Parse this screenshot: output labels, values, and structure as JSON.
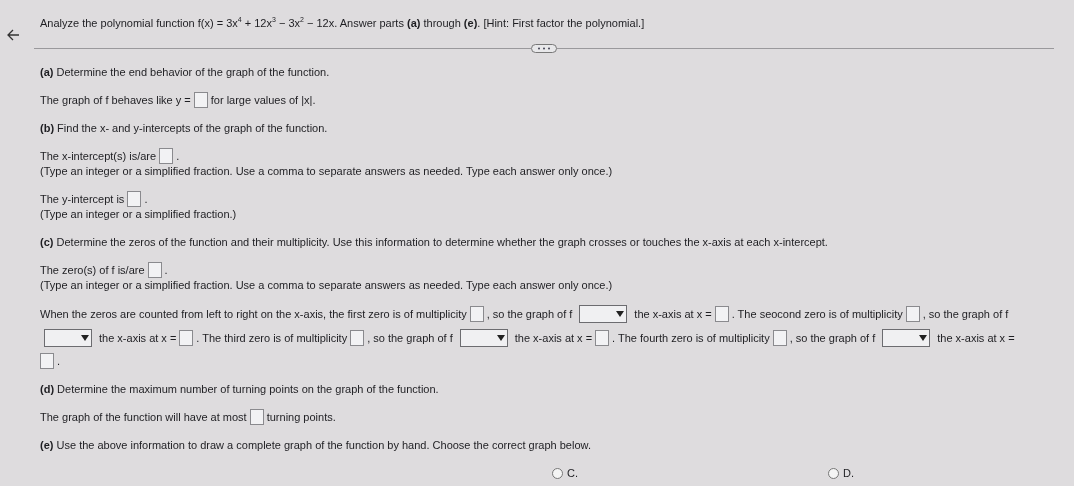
{
  "header": {
    "instruction": "Analyze the polynomial function f(x) = 3x$^{4}$ + 12x$^{3}$ − 3x$^{2}$ − 12x. Answer parts **(a)** through **(e)**. [Hint: First factor the polynomial.]"
  },
  "lines": [
    {
      "kind": "heading",
      "parts": [
        {
          "kind": "text",
          "text": "**(a)** Determine the end behavior of the graph of the function."
        }
      ]
    },
    {
      "kind": "prompt",
      "parts": [
        {
          "kind": "text",
          "text": "The graph of f behaves like y ="
        },
        {
          "kind": "box"
        },
        {
          "kind": "text",
          "text": "for large values of |x|."
        }
      ]
    },
    {
      "kind": "heading",
      "parts": [
        {
          "kind": "text",
          "text": "**(b)** Find the x- and y-intercepts of the graph of the function."
        }
      ]
    },
    {
      "kind": "prompt",
      "parts": [
        {
          "kind": "text",
          "text": "The x-intercept(s) is/are"
        },
        {
          "kind": "box"
        },
        {
          "kind": "text",
          "text": "."
        }
      ]
    },
    {
      "kind": "note",
      "parts": [
        {
          "kind": "text",
          "text": "(Type an integer or a simplified fraction. Use a comma to separate answers as needed. Type each answer only once.)"
        }
      ]
    },
    {
      "kind": "prompt",
      "parts": [
        {
          "kind": "text",
          "text": "The y-intercept is"
        },
        {
          "kind": "box"
        },
        {
          "kind": "text",
          "text": "."
        }
      ]
    },
    {
      "kind": "note",
      "parts": [
        {
          "kind": "text",
          "text": "(Type an integer or a simplified fraction.)"
        }
      ]
    },
    {
      "kind": "heading",
      "parts": [
        {
          "kind": "text",
          "text": "**(c)** Determine the zeros of the function and their multiplicity. Use this information to determine whether the graph crosses or touches the x-axis at each x-intercept."
        }
      ]
    },
    {
      "kind": "prompt",
      "parts": [
        {
          "kind": "text",
          "text": "The zero(s) of f is/are"
        },
        {
          "kind": "box"
        },
        {
          "kind": "text",
          "text": "."
        }
      ]
    },
    {
      "kind": "note",
      "parts": [
        {
          "kind": "text",
          "text": "(Type an integer or a simplified fraction. Use a comma to separate answers as needed. Type each answer only once.)"
        }
      ]
    },
    {
      "kind": "prompt",
      "parts": [
        {
          "kind": "text",
          "text": "When the zeros are counted from left to right on the x-axis, the first zero is of multiplicity"
        },
        {
          "kind": "box"
        },
        {
          "kind": "text",
          "text": ", so the graph of f"
        },
        {
          "kind": "dropdown"
        },
        {
          "kind": "text",
          "text": "the x-axis at x ="
        },
        {
          "kind": "box"
        },
        {
          "kind": "text",
          "text": ". The seocond zero is of multiplicity"
        },
        {
          "kind": "box"
        },
        {
          "kind": "text",
          "text": ", so the graph of f"
        },
        {
          "kind": "dropdown"
        },
        {
          "kind": "text",
          "text": "the x-axis at x ="
        },
        {
          "kind": "box"
        },
        {
          "kind": "text",
          "text": ". The third zero is of multiplicity"
        },
        {
          "kind": "box"
        },
        {
          "kind": "text",
          "text": ", so the graph of f"
        },
        {
          "kind": "dropdown"
        },
        {
          "kind": "text",
          "text": "the x-axis at x ="
        },
        {
          "kind": "box"
        },
        {
          "kind": "text",
          "text": ". The fourth zero is of multiplicity"
        },
        {
          "kind": "box"
        },
        {
          "kind": "text",
          "text": ", so the graph of f"
        },
        {
          "kind": "dropdown"
        },
        {
          "kind": "text",
          "text": "the x-axis at"
        },
        {
          "kind": "text",
          "text": "x ="
        },
        {
          "kind": "box"
        },
        {
          "kind": "text",
          "text": "."
        }
      ]
    },
    {
      "kind": "heading",
      "parts": [
        {
          "kind": "text",
          "text": "**(d)** Determine the maximum number of turning points on the graph of the function."
        }
      ]
    },
    {
      "kind": "prompt",
      "parts": [
        {
          "kind": "text",
          "text": "The graph of the function will have at most"
        },
        {
          "kind": "box"
        },
        {
          "kind": "text",
          "text": "turning points."
        }
      ]
    },
    {
      "kind": "heading",
      "parts": [
        {
          "kind": "text",
          "text": "**(e)** Use the above information to draw a complete graph of the function by hand. Choose the correct graph below."
        }
      ]
    }
  ],
  "options": [
    {
      "label": "C.",
      "selected": false
    },
    {
      "label": "D.",
      "selected": false
    }
  ]
}
